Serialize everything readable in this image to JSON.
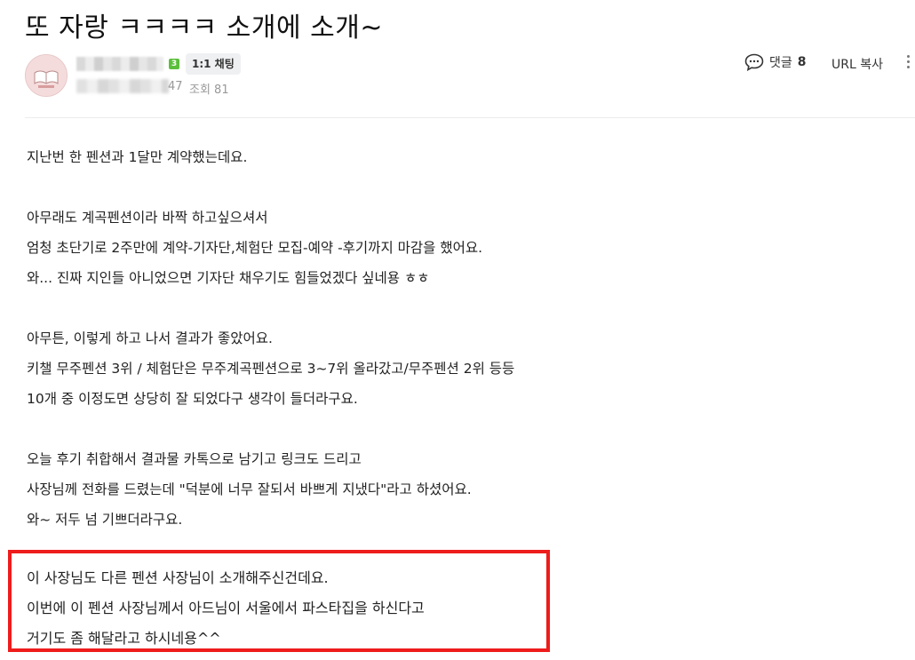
{
  "post": {
    "title": "또 자랑 ㅋㅋㅋㅋ 소개에 소개~"
  },
  "author": {
    "level": "3",
    "chat_label": "1:1 채팅",
    "date_fragment": "47",
    "views": "조회 81"
  },
  "actions": {
    "comment_label": "댓글",
    "comment_count": "8",
    "url_copy_label": "URL 복사"
  },
  "body": {
    "p1": [
      "지난번 한 펜션과 1달만 계약했는데요."
    ],
    "p2": [
      "아무래도 계곡펜션이라 바짝 하고싶으셔서",
      "엄청 초단기로 2주만에 계약-기자단,체험단 모집-예약 -후기까지 마감을 했어요.",
      "와... 진짜 지인들 아니었으면 기자단 채우기도 힘들었겠다 싶네용 ㅎㅎ"
    ],
    "p3": [
      "아무튼, 이렇게 하고 나서 결과가 좋았어요.",
      "키챌 무주펜션 3위 / 체험단은 무주계곡펜션으로 3~7위 올라갔고/무주펜션 2위 등등",
      "10개 중 이정도면 상당히 잘 되었다구 생각이 들더라구요."
    ],
    "p4": [
      "오늘 후기 취합해서 결과물 카톡으로 남기고 링크도 드리고",
      "사장님께 전화를 드렸는데 \"덕분에 너무 잘되서 바쁘게 지냈다\"라고 하셨어요.",
      "와~ 저두 넘 기쁘더라구요."
    ],
    "highlight": [
      "이 사장님도 다른 펜션 사장님이 소개해주신건데요.",
      "이번에 이 펜션 사장님께서 아드님이 서울에서 파스타집을 하신다고",
      "거기도 좀 해달라고 하시네용^^"
    ]
  },
  "colors": {
    "highlight_border": "#ee1c1c",
    "level_badge": "#5cbf3c"
  }
}
